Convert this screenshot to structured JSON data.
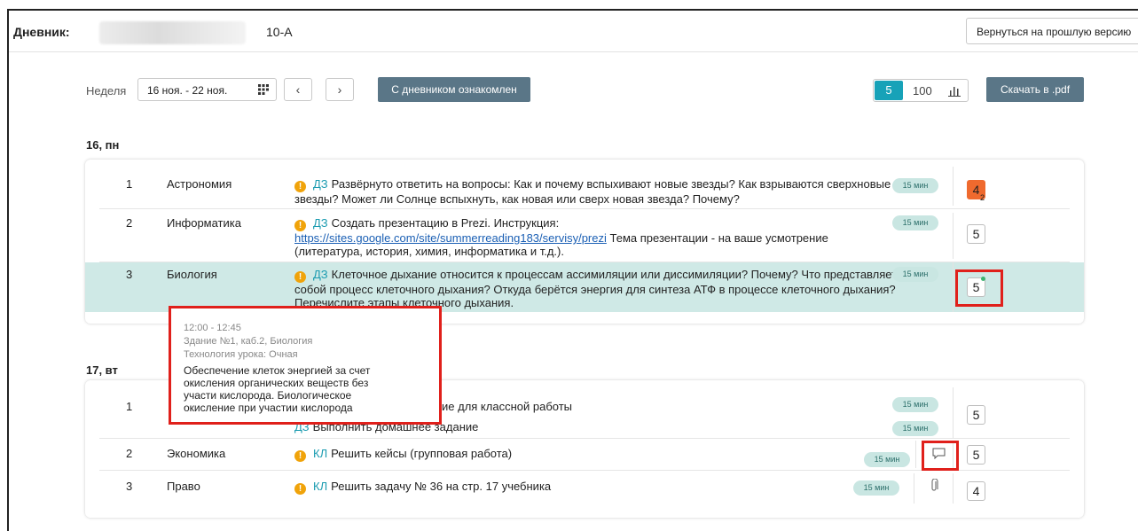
{
  "header": {
    "title": "Дневник:",
    "class_name": "10-А",
    "back_button": "Вернуться на прошлую версию"
  },
  "toolbar": {
    "week_label": "Неделя",
    "week_range": "16 ноя. - 22 ноя.",
    "prev_label": "‹",
    "next_label": "›",
    "acknowledge_button": "С дневником ознакомлен",
    "scale_active": "5",
    "scale_other": "100",
    "download_button": "Скачать в .pdf"
  },
  "days": [
    {
      "label": "16, пн",
      "lessons": [
        {
          "num": "1",
          "subject": "Астрономия",
          "type": "ДЗ",
          "task": "Развёрнуто ответить на вопросы: Как и почему вспыхивают новые звезды? Как взрываются сверхновые звезды? Может ли Солнце вспыхнуть, как новая или сверх новая звезда? Почему?",
          "duration": "15 мин",
          "grade": "4",
          "grade_sub": "2"
        },
        {
          "num": "2",
          "subject": "Информатика",
          "type": "ДЗ",
          "task_before": "Создать презентацию в Prezi. Инструкция:",
          "link": "https://sites.google.com/site/summerreading183/servisy/prezi",
          "task_after": "Тема презентации - на ваше усмотрение (литература, история, химия, информатика и т.д.).",
          "duration": "15 мин",
          "grade": "5"
        },
        {
          "num": "3",
          "subject": "Биология",
          "type": "ДЗ",
          "task": "Клеточное дыхание относится к процессам ассимиляции или диссимиляции? Почему? Что представляет собой процесс клеточного дыхания? Откуда берётся энергия для синтеза АТФ в процессе клеточного дыхания? Перечислите этапы клеточного дыхания.",
          "duration": "15 мин",
          "grade": "5"
        }
      ]
    },
    {
      "label": "17, вт",
      "lessons": [
        {
          "num": "1",
          "task_fragment": "ие для классной работы",
          "type_2": "ДЗ",
          "task_2": "Выполнить домашнее задание",
          "duration": "15 мин",
          "duration_2": "15 мин",
          "grade": "5"
        },
        {
          "num": "2",
          "subject": "Экономика",
          "type": "КЛ",
          "task": "Решить кейсы (групповая работа)",
          "duration": "15 мин",
          "grade": "5"
        },
        {
          "num": "3",
          "subject": "Право",
          "type": "КЛ",
          "task": "Решить задачу № 36 на стр. 17 учебника",
          "duration": "15 мин",
          "grade": "4"
        }
      ]
    }
  ],
  "tooltip": {
    "time": "12:00 - 12:45",
    "room": "Здание №1, каб.2, Биология",
    "technology": "Технология урока: Очная",
    "description": "Обеспечение клеток энергией за счет окисления органических веществ без участи кислорода. Биологическое окисление при участии кислорода"
  },
  "icons": {
    "warning": "!",
    "calendar": "calendar-icon",
    "chart": "bar-chart-icon",
    "comment": "comment-icon",
    "attachment": "paperclip-icon"
  },
  "colors": {
    "accent": "#17a2b8",
    "button": "#5a7687",
    "highlight_row": "#cfe9e6",
    "warning": "#f0a30a",
    "grade_bad": "#ef6a2e",
    "annotation": "#e0201b"
  }
}
